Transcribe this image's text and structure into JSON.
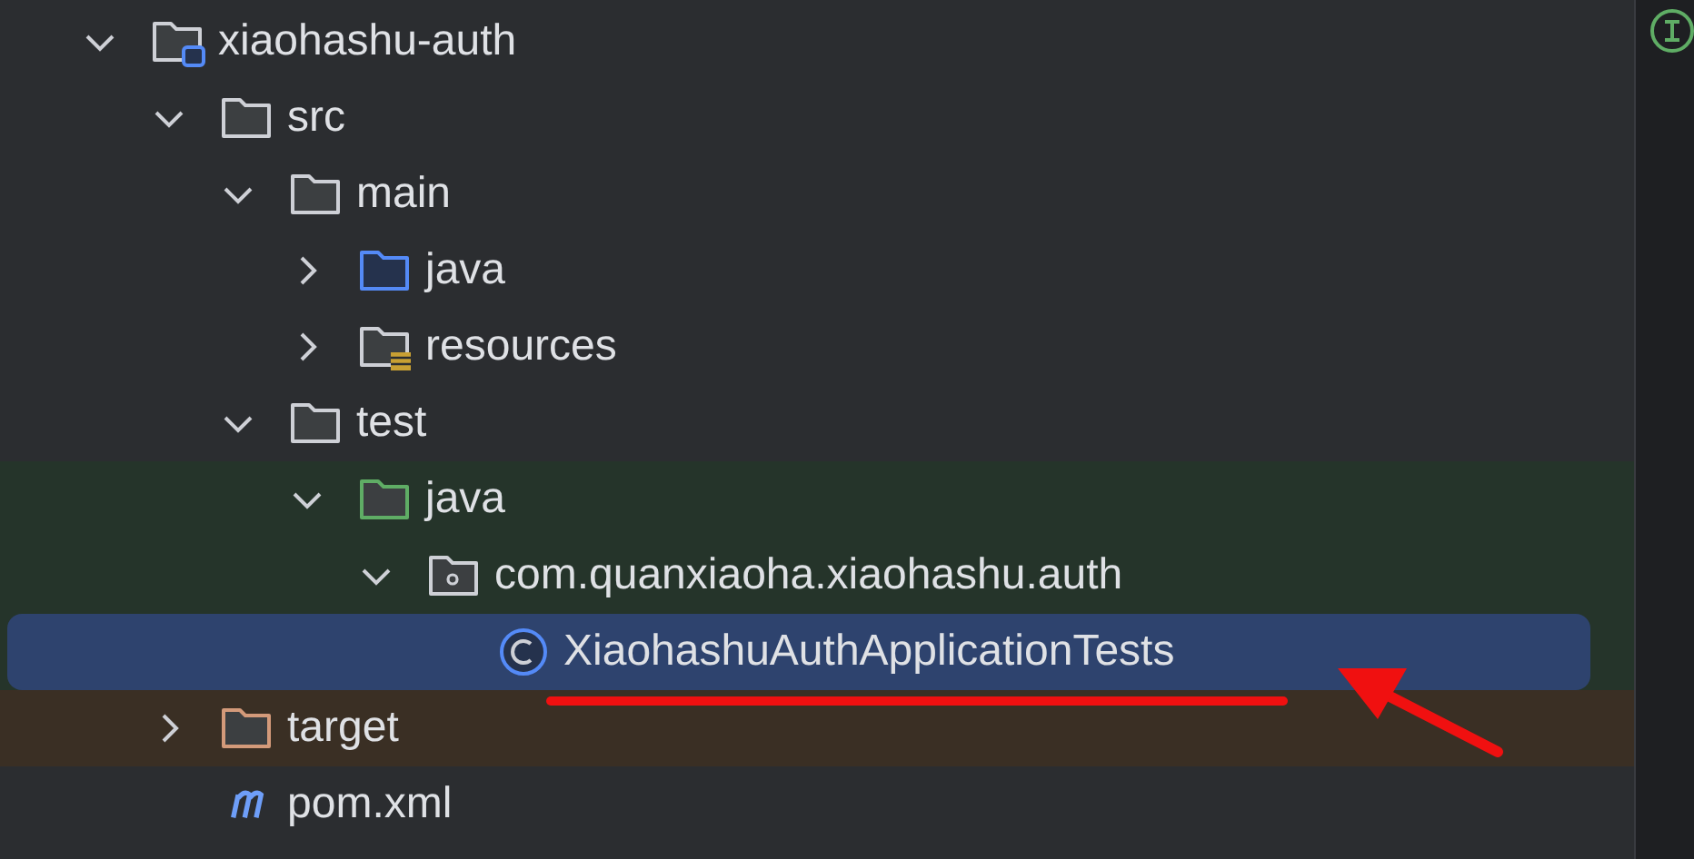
{
  "project_tree": [
    {
      "name": "xiaohashu-auth",
      "kind": "module",
      "expanded": true,
      "selected": false,
      "children": [
        {
          "name": "src",
          "kind": "folder",
          "expanded": true,
          "selected": false,
          "children": [
            {
              "name": "main",
              "kind": "folder",
              "expanded": true,
              "selected": false,
              "children": [
                {
                  "name": "java",
                  "kind": "source-folder",
                  "expanded": false,
                  "selected": false
                },
                {
                  "name": "resources",
                  "kind": "resources-folder",
                  "expanded": false,
                  "selected": false
                }
              ]
            },
            {
              "name": "test",
              "kind": "folder",
              "expanded": true,
              "selected": false,
              "children": [
                {
                  "name": "java",
                  "kind": "test-folder",
                  "expanded": true,
                  "selected": false,
                  "children": [
                    {
                      "name": "com.quanxiaoha.xiaohashu.auth",
                      "kind": "package",
                      "expanded": true,
                      "selected": false,
                      "children": [
                        {
                          "name": "XiaohashuAuthApplicationTests",
                          "kind": "class",
                          "selected": true
                        }
                      ]
                    }
                  ]
                }
              ]
            }
          ]
        },
        {
          "name": "target",
          "kind": "excluded-folder",
          "expanded": false,
          "selected": false
        },
        {
          "name": "pom.xml",
          "kind": "maven-file",
          "selected": false
        }
      ]
    }
  ]
}
